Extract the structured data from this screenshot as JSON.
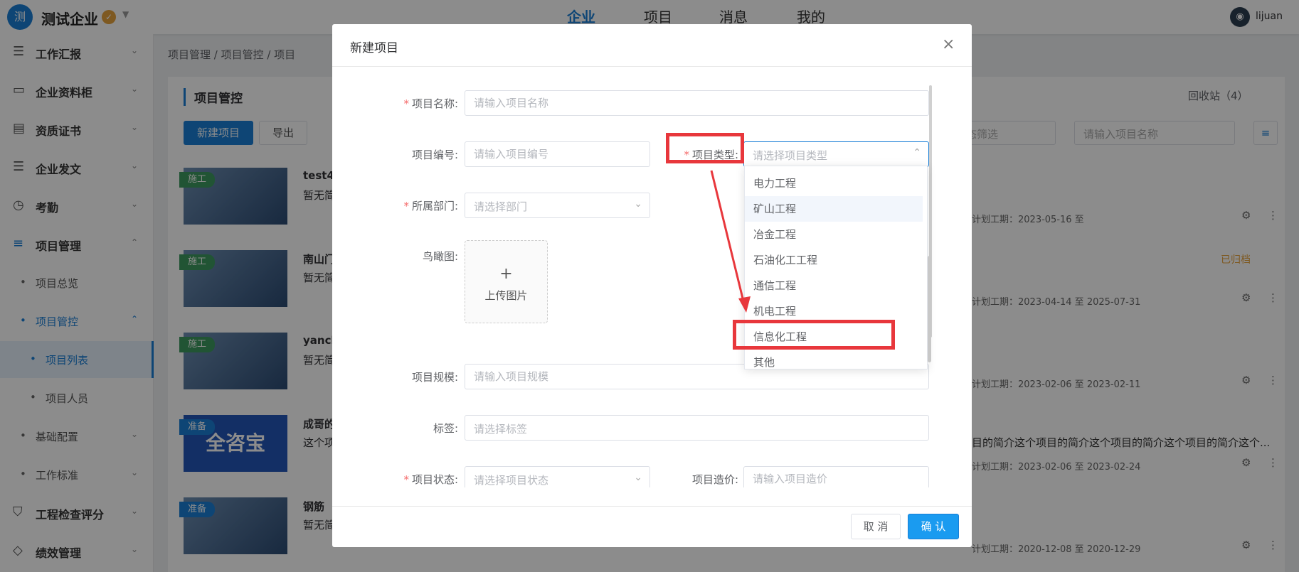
{
  "topbar": {
    "logo_char": "测",
    "company": "测试企业",
    "verified_icon": "✓",
    "nav": [
      "企业",
      "项目",
      "消息",
      "我的"
    ],
    "username": "lijuan"
  },
  "sidebar": {
    "items": [
      {
        "label": "工作汇报",
        "icon": "☰"
      },
      {
        "label": "企业资料柜",
        "icon": "▭"
      },
      {
        "label": "资质证书",
        "icon": "▤"
      },
      {
        "label": "企业发文",
        "icon": "☰"
      },
      {
        "label": "考勤",
        "icon": "◷"
      },
      {
        "label": "项目管理",
        "icon": "≡"
      }
    ],
    "subs": [
      "项目总览",
      "项目管控",
      "项目列表",
      "项目人员",
      "基础配置",
      "工作标准"
    ],
    "bottom": [
      {
        "label": "工程检查评分",
        "icon": "⛉"
      },
      {
        "label": "绩效管理",
        "icon": "◇"
      }
    ]
  },
  "breadcrumb": "项目管理 / 项目管控 / 项目",
  "page": {
    "title": "项目管控",
    "new_btn": "新建项目",
    "export_btn": "导出",
    "recycle": "回收站（4）",
    "status_filter": "状态筛选",
    "search_ph": "请输入项目名称"
  },
  "rows": [
    {
      "name": "test4",
      "desc": "暂无简",
      "tag": "施工",
      "dates": "计划工期：2023-05-16 至"
    },
    {
      "name": "南山门",
      "desc": "暂无简",
      "tag": "施工",
      "dates": "计划工期：2023-04-14 至 2025-07-31",
      "archived": "已归档"
    },
    {
      "name": "yanch",
      "desc": "暂无简",
      "tag": "施工",
      "dates": "计划工期：2023-02-06 至 2023-02-11"
    },
    {
      "name": "成哥的",
      "desc": "这个项",
      "tag": "准备",
      "dates": "计划工期：2023-02-06 至 2023-02-24",
      "long_desc": "目的简介这个项目的简介这个项目的简介这个项目的简介这个..."
    },
    {
      "name": "钢筋",
      "desc": "暂无简",
      "tag": "准备",
      "dates": "计划工期：2020-12-08 至 2020-12-29"
    }
  ],
  "thumb_text": "全咨宝",
  "modal": {
    "title": "新建项目",
    "close": "×",
    "fields": {
      "name_label": "项目名称:",
      "name_ph": "请输入项目名称",
      "code_label": "项目编号:",
      "code_ph": "请输入项目编号",
      "type_label": "项目类型:",
      "type_ph": "请选择项目类型",
      "dept_label": "所属部门:",
      "dept_ph": "请选择部门",
      "aerial_label": "鸟瞰图:",
      "upload_plus": "+",
      "upload_text": "上传图片",
      "scale_label": "项目规模:",
      "scale_ph": "请输入项目规模",
      "tags_label": "标签:",
      "tags_ph": "请选择标签",
      "status_label": "项目状态:",
      "status_ph": "请选择项目状态",
      "cost_label": "项目造价:",
      "cost_ph": "请输入项目造价"
    },
    "required_mark": "*",
    "dropdown": [
      "电力工程",
      "矿山工程",
      "冶金工程",
      "石油化工工程",
      "通信工程",
      "机电工程",
      "信息化工程",
      "其他"
    ],
    "cancel": "取 消",
    "confirm": "确 认"
  },
  "colors": {
    "primary": "#1a7fd6",
    "highlight": "#e8373c"
  }
}
